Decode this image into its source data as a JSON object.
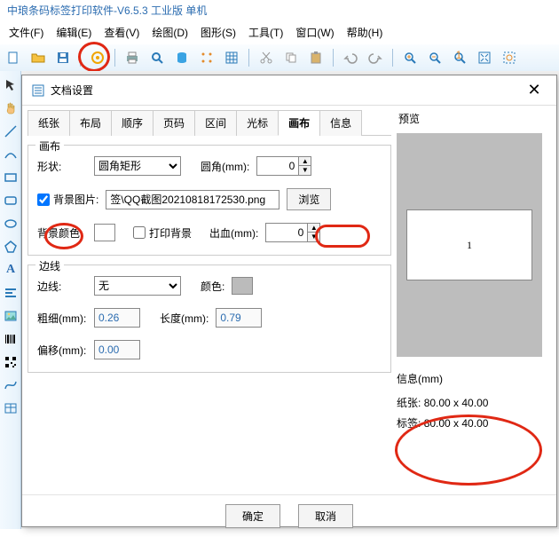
{
  "titlebar": "中琅条码标签打印软件-V6.5.3 工业版 单机",
  "menubar": [
    "文件(F)",
    "编辑(E)",
    "查看(V)",
    "绘图(D)",
    "图形(S)",
    "工具(T)",
    "窗口(W)",
    "帮助(H)"
  ],
  "dialog": {
    "title": "文档设置",
    "tabs": [
      "纸张",
      "布局",
      "顺序",
      "页码",
      "区间",
      "光标",
      "画布",
      "信息"
    ],
    "activeTab": "画布",
    "canvas": {
      "legend": "画布",
      "shapeLabel": "形状:",
      "shapeValue": "圆角矩形",
      "radiusLabel": "圆角(mm):",
      "radiusValue": "0",
      "bgImgLabel": "背景图片:",
      "bgImgPath": "签\\QQ截图20210818172530.png",
      "browseBtn": "浏览",
      "bgColorLabel": "背景颜色:",
      "printBgLabel": "打印背景",
      "printBgChecked": false,
      "bleedLabel": "出血(mm):",
      "bleedValue": "0"
    },
    "border": {
      "legend": "边线",
      "borderLabel": "边线:",
      "borderValue": "无",
      "colorLabel": "颜色:",
      "thickLabel": "粗细(mm):",
      "thickValue": "0.26",
      "lengthLabel": "长度(mm):",
      "lengthValue": "0.79",
      "offsetLabel": "偏移(mm):",
      "offsetValue": "0.00"
    },
    "buttons": {
      "ok": "确定",
      "cancel": "取消"
    },
    "preview": {
      "title": "预览",
      "pageText": "1",
      "infoTitle": "信息(mm)",
      "paperLabel": "纸张:",
      "paperSize": "80.00 x 40.00",
      "labelLabel": "标签:",
      "labelSize": "80.00 x 40.00"
    }
  }
}
